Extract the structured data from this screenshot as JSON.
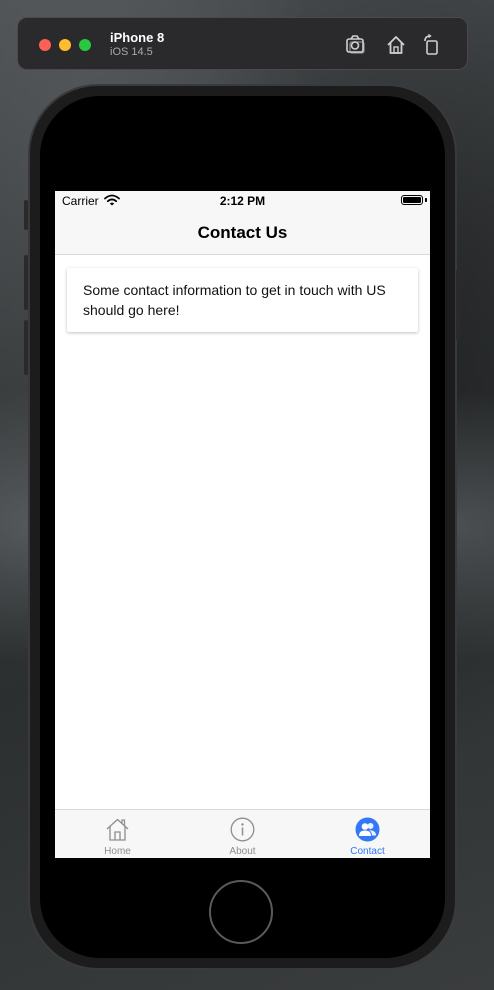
{
  "simulator": {
    "device_name": "iPhone 8",
    "os_version": "iOS 14.5",
    "toolbar_icons": [
      "screenshot-icon",
      "home-icon",
      "rotate-icon"
    ]
  },
  "status_bar": {
    "carrier": "Carrier",
    "time": "2:12 PM"
  },
  "nav": {
    "title": "Contact Us"
  },
  "card": {
    "text": "Some contact information to get in touch with US should go here!"
  },
  "tabs": [
    {
      "label": "Home",
      "icon": "house-icon",
      "active": false
    },
    {
      "label": "About",
      "icon": "info-icon",
      "active": false
    },
    {
      "label": "Contact",
      "icon": "contacts-icon",
      "active": true
    }
  ],
  "colors": {
    "accent": "#3478f6",
    "inactive_tab": "#8e8e93",
    "nav_background": "#f7f7f7"
  }
}
